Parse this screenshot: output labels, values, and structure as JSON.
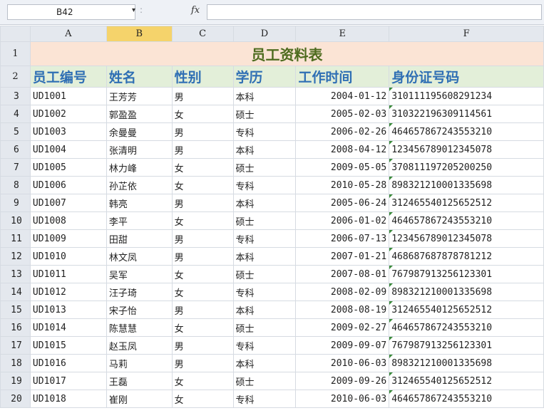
{
  "formula_bar": {
    "name_box": "B42",
    "dropdown_arrow": "▾",
    "separator": ":",
    "fx_label": "fx",
    "formula_value": ""
  },
  "columns": [
    "A",
    "B",
    "C",
    "D",
    "E",
    "F"
  ],
  "selected_column": "B",
  "row_numbers": [
    "1",
    "2",
    "3",
    "4",
    "5",
    "6",
    "7",
    "8",
    "9",
    "10",
    "11",
    "12",
    "13",
    "14",
    "15",
    "16",
    "17",
    "18",
    "19",
    "20"
  ],
  "sheet": {
    "title": "员工资料表",
    "headers": [
      "员工编号",
      "姓名",
      "性别",
      "学历",
      "工作时间",
      "身份证号码"
    ],
    "rows": [
      [
        "UD1001",
        "王芳芳",
        "男",
        "本科",
        "2004-01-12",
        "310111195608291234"
      ],
      [
        "UD1002",
        "郭盈盈",
        "女",
        "硕士",
        "2005-02-03",
        "310322196309114561"
      ],
      [
        "UD1003",
        "余曼曼",
        "男",
        "专科",
        "2006-02-26",
        "464657867243553210"
      ],
      [
        "UD1004",
        "张清明",
        "男",
        "本科",
        "2008-04-12",
        "123456789012345078"
      ],
      [
        "UD1005",
        "林力峰",
        "女",
        "硕士",
        "2009-05-05",
        "370811197205200250"
      ],
      [
        "UD1006",
        "孙芷依",
        "女",
        "专科",
        "2010-05-28",
        "898321210001335698"
      ],
      [
        "UD1007",
        "韩亮",
        "男",
        "本科",
        "2005-06-24",
        "312465540125652512"
      ],
      [
        "UD1008",
        "李平",
        "女",
        "硕士",
        "2006-01-02",
        "464657867243553210"
      ],
      [
        "UD1009",
        "田甜",
        "男",
        "专科",
        "2006-07-13",
        "123456789012345078"
      ],
      [
        "UD1010",
        "林文凤",
        "男",
        "本科",
        "2007-01-21",
        "468687687878781212"
      ],
      [
        "UD1011",
        "吴军",
        "女",
        "硕士",
        "2007-08-01",
        "767987913256123301"
      ],
      [
        "UD1012",
        "汪子琦",
        "女",
        "专科",
        "2008-02-09",
        "898321210001335698"
      ],
      [
        "UD1013",
        "宋子怡",
        "男",
        "本科",
        "2008-08-19",
        "312465540125652512"
      ],
      [
        "UD1014",
        "陈慧慧",
        "女",
        "硕士",
        "2009-02-27",
        "464657867243553210"
      ],
      [
        "UD1015",
        "赵玉凤",
        "男",
        "专科",
        "2009-09-07",
        "767987913256123301"
      ],
      [
        "UD1016",
        "马莉",
        "男",
        "本科",
        "2010-06-03",
        "898321210001335698"
      ],
      [
        "UD1017",
        "王磊",
        "女",
        "硕士",
        "2009-09-26",
        "312465540125652512"
      ],
      [
        "UD1018",
        "崔刚",
        "女",
        "专科",
        "2010-06-03",
        "464657867243553210"
      ]
    ]
  },
  "colors": {
    "title_bg": "#fbe4d5",
    "title_text": "#4d6b1e",
    "header_bg": "#e3efd9",
    "header_text": "#2f6fb4",
    "selected_col_header": "#f5d36b",
    "error_indicator": "#3a8a3a"
  }
}
